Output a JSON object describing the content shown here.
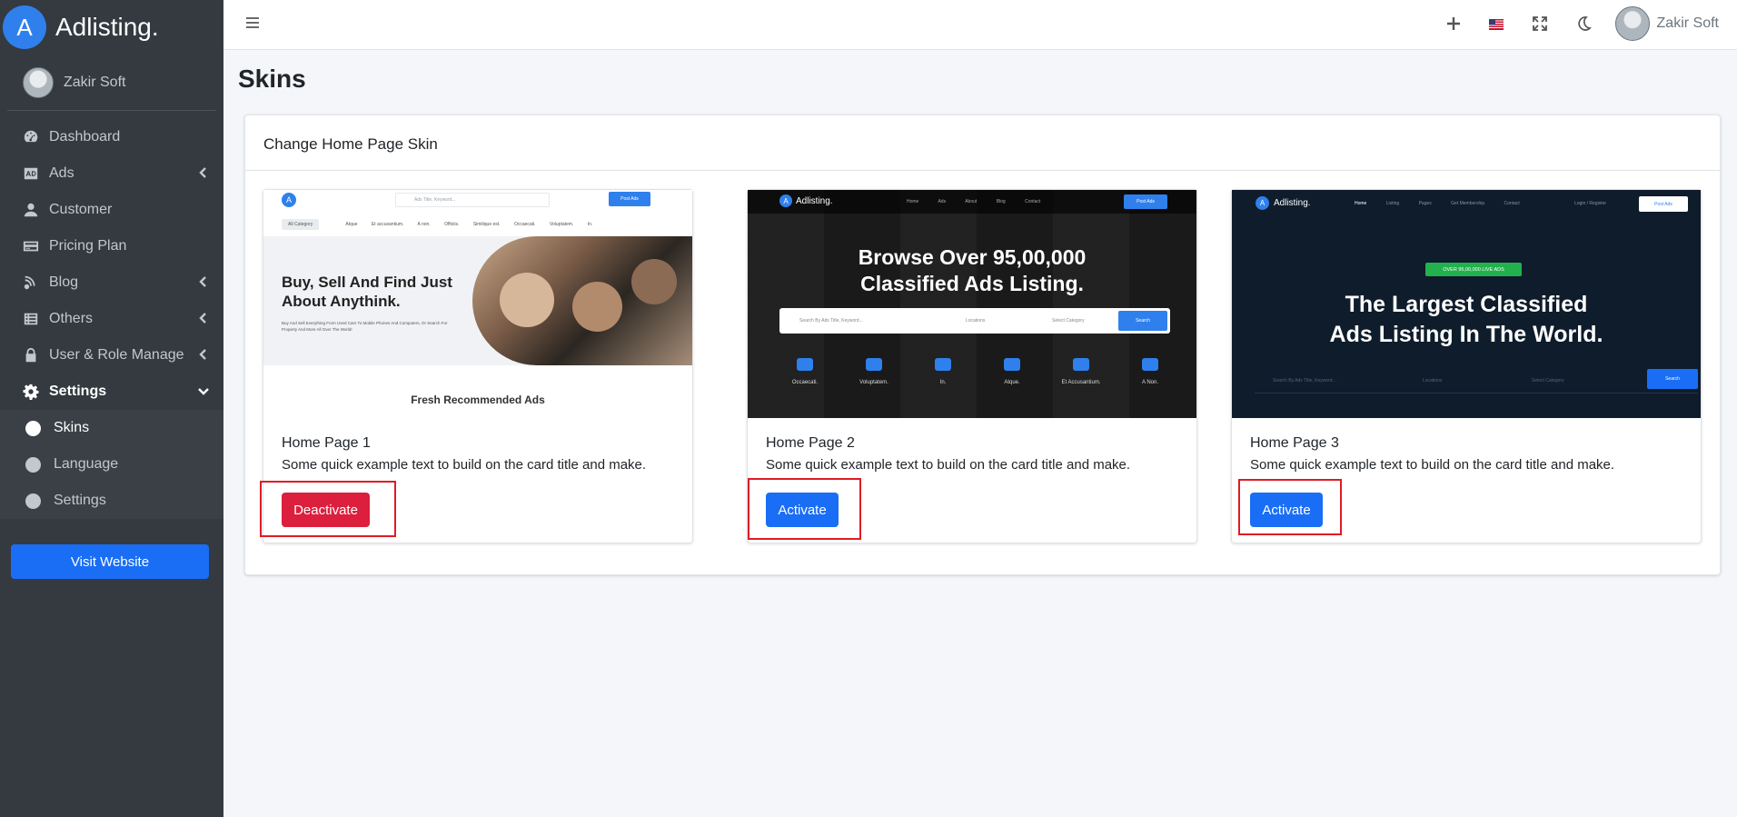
{
  "brand": {
    "logo_letter": "A",
    "name": "Adlisting."
  },
  "sidebar": {
    "user_name": "Zakir Soft",
    "items": [
      {
        "label": "Dashboard",
        "icon": "dashboard-icon"
      },
      {
        "label": "Ads",
        "icon": "ads-icon",
        "has_submenu": true
      },
      {
        "label": "Customer",
        "icon": "user-icon"
      },
      {
        "label": "Pricing Plan",
        "icon": "credit-card-icon"
      },
      {
        "label": "Blog",
        "icon": "blog-icon",
        "has_submenu": true
      },
      {
        "label": "Others",
        "icon": "list-icon",
        "has_submenu": true
      },
      {
        "label": "User & Role Manage",
        "icon": "lock-icon",
        "has_submenu": true
      },
      {
        "label": "Settings",
        "icon": "gear-icon",
        "expanded": true
      }
    ],
    "settings_sub": [
      {
        "label": "Skins",
        "active": true
      },
      {
        "label": "Language"
      },
      {
        "label": "Settings"
      }
    ],
    "visit_website": "Visit Website"
  },
  "header": {
    "user_name": "Zakir Soft"
  },
  "page": {
    "title": "Skins"
  },
  "card": {
    "title": "Change Home Page Skin",
    "skins": [
      {
        "title": "Home Page 1",
        "description": "Some quick example text to build on the card title and make.",
        "button": "Deactivate",
        "preview": {
          "logo": "A",
          "search_placeholder": "Ads Title, Keyword...",
          "post_ads": "Post Ads",
          "category": "All Category",
          "categories": [
            "Atque",
            "Et accusantium.",
            "A non.",
            "Officiis.",
            "Similique est.",
            "Occaecati.",
            "Voluptatem.",
            "In."
          ],
          "hero_title": "Buy, Sell And Find Just About Anythink.",
          "hero_sub": "Buy And Sell Everything From Used Cars To Mobile Phones And Computers, Or Search For Property And More All Over The World!",
          "section": "Fresh Recommended Ads"
        }
      },
      {
        "title": "Home Page 2",
        "description": "Some quick example text to build on the card title and make.",
        "button": "Activate",
        "preview": {
          "logo_letter": "A",
          "logo_name": "Adlisting.",
          "menu": [
            "Home",
            "Ads",
            "About",
            "Blog",
            "Contact"
          ],
          "post_ads": "Post Ads",
          "hero_line1": "Browse Over 95,00,000",
          "hero_line2": "Classified Ads Listing.",
          "search_placeholder": "Search By Ads Title, Keyword...",
          "location": "Locations",
          "category": "Select Category",
          "search": "Search",
          "categories": [
            "Occaecati.",
            "Voluptatem.",
            "In.",
            "Atque.",
            "Et Accusantium.",
            "A Non."
          ]
        }
      },
      {
        "title": "Home Page 3",
        "description": "Some quick example text to build on the card title and make.",
        "button": "Activate",
        "preview": {
          "logo_letter": "A",
          "logo_name": "Adlisting.",
          "menu": [
            "Home",
            "Listing",
            "Pages",
            "Get Membership",
            "Contact"
          ],
          "login": "Login / Register",
          "post_ads": "Post Ads",
          "badge": "OVER 95,00,000 LIVE ADS",
          "hero_line1": "The Largest Classified",
          "hero_line2": "Ads Listing In The World.",
          "search_placeholder": "Search By Ads Title, Keyword...",
          "location": "Locations",
          "category": "Select Category",
          "search": "Search"
        }
      }
    ]
  },
  "colors": {
    "sidebar_bg": "#343a40",
    "primary": "#1a6ef5",
    "danger": "#dc1f3c",
    "highlight": "#e01b24"
  }
}
